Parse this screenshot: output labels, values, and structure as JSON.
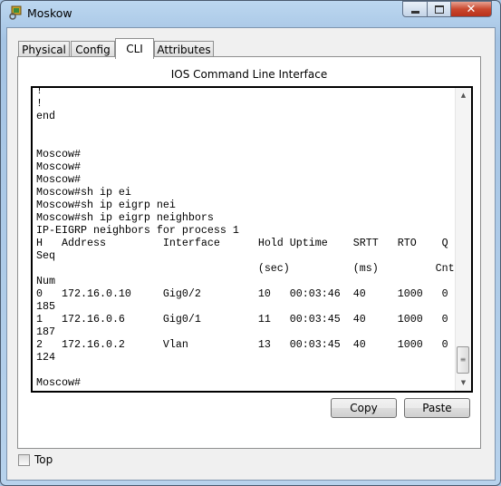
{
  "window": {
    "title": "Moskow",
    "icon": "packet-tracer-router-icon"
  },
  "tabs": [
    {
      "label": "Physical",
      "active": false
    },
    {
      "label": "Config",
      "active": false
    },
    {
      "label": "CLI",
      "active": true
    },
    {
      "label": "Attributes",
      "active": false
    }
  ],
  "cli": {
    "heading": "IOS Command Line Interface",
    "lines": [
      "!",
      "!",
      "end",
      "",
      "",
      "Moscow#",
      "Moscow#",
      "Moscow#",
      "Moscow#sh ip ei",
      "Moscow#sh ip eigrp nei",
      "Moscow#sh ip eigrp neighbors",
      "IP-EIGRP neighbors for process 1",
      "H   Address         Interface      Hold Uptime    SRTT   RTO    Q",
      "Seq",
      "                                   (sec)          (ms)         Cnt",
      "Num",
      "0   172.16.0.10     Gig0/2         10   00:03:46  40     1000   0",
      "185",
      "1   172.16.0.6      Gig0/1         11   00:03:45  40     1000   0",
      "187",
      "2   172.16.0.2      Vlan           13   00:03:45  40     1000   0",
      "124",
      "",
      "Moscow#"
    ]
  },
  "buttons": {
    "copy": "Copy",
    "paste": "Paste"
  },
  "top_checkbox": {
    "label": "Top",
    "checked": false
  }
}
